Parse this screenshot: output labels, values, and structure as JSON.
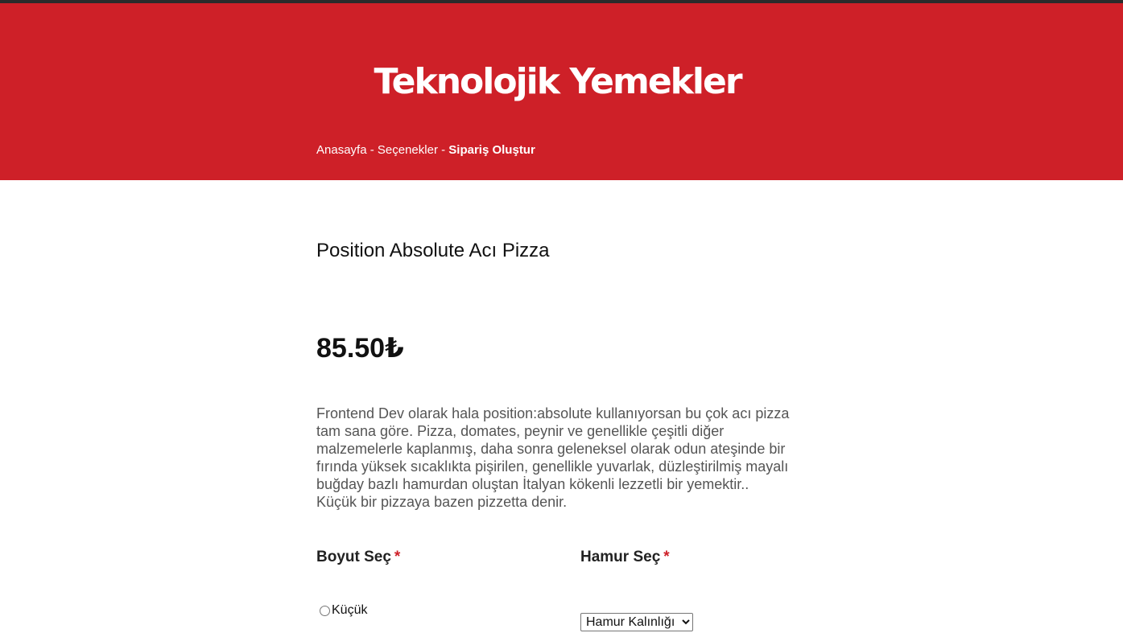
{
  "header": {
    "brand": "Teknolojik Yemekler",
    "breadcrumb": {
      "home": "Anasayfa",
      "separator": " - ",
      "options": "Seçenekler",
      "current": "Sipariş Oluştur"
    },
    "background_color": "#ce2028"
  },
  "product": {
    "name": "Position Absolute Acı Pizza",
    "price": "85.50₺",
    "description": "Frontend Dev olarak hala position:absolute kullanıyorsan bu çok acı pizza tam sana göre. Pizza, domates, peynir ve genellikle çeşitli diğer malzemelerle kaplanmış, daha sonra geleneksel olarak odun ateşinde bir fırında yüksek sıcaklıkta pişirilen, genellikle yuvarlak, düzleştirilmiş mayalı buğday bazlı hamurdan oluştan İtalyan kökenli lezzetli bir yemektir.. Küçük bir pizzaya bazen pizzetta denir."
  },
  "form": {
    "size": {
      "label": "Boyut Seç",
      "required_mark": "*",
      "options": [
        {
          "label": "Küçük",
          "checked": false
        }
      ]
    },
    "dough": {
      "label": "Hamur Seç",
      "required_mark": "*",
      "selected": "Hamur Kalınlığı"
    }
  }
}
